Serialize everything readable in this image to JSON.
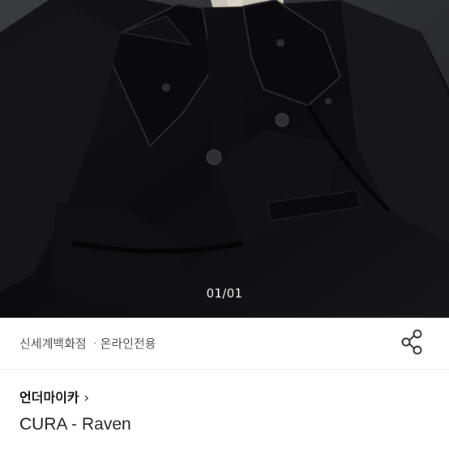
{
  "gallery": {
    "page_indicator": "01/01"
  },
  "store": {
    "department": "신세계백화점",
    "separator": "·",
    "channel": "온라인전용"
  },
  "brand": {
    "name": "언더마이카",
    "chevron": "›"
  },
  "product": {
    "title": "CURA - Raven"
  },
  "icons": {
    "share": "share-icon"
  }
}
